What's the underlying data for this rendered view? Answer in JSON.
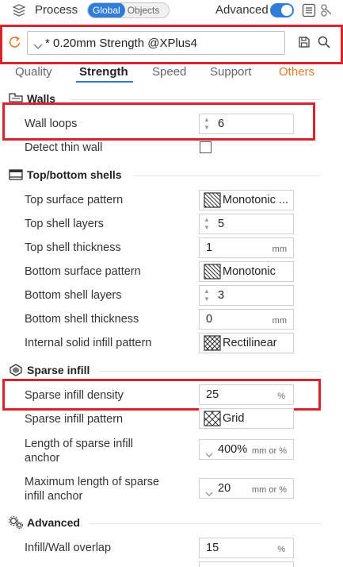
{
  "header": {
    "title": "Process",
    "seg_global": "Global",
    "seg_objects": "Objects",
    "advanced_label": "Advanced"
  },
  "preset": {
    "name": "* 0.20mm Strength @XPlus4"
  },
  "tabs": [
    "Quality",
    "Strength",
    "Speed",
    "Support",
    "Others"
  ],
  "sections": {
    "walls": "Walls",
    "top_bottom": "Top/bottom shells",
    "sparse": "Sparse infill",
    "advanced": "Advanced"
  },
  "settings": {
    "wall_loops": {
      "label": "Wall loops",
      "value": "6"
    },
    "detect_thin_wall": {
      "label": "Detect thin wall"
    },
    "top_surface_pattern": {
      "label": "Top surface pattern",
      "value": "Monotonic ..."
    },
    "top_shell_layers": {
      "label": "Top shell layers",
      "value": "5"
    },
    "top_shell_thickness": {
      "label": "Top shell thickness",
      "value": "1",
      "unit": "mm"
    },
    "bottom_surface_pattern": {
      "label": "Bottom surface pattern",
      "value": "Monotonic"
    },
    "bottom_shell_layers": {
      "label": "Bottom shell layers",
      "value": "3"
    },
    "bottom_shell_thickness": {
      "label": "Bottom shell thickness",
      "value": "0",
      "unit": "mm"
    },
    "internal_solid_infill_pattern": {
      "label": "Internal solid infill pattern",
      "value": "Rectilinear"
    },
    "sparse_infill_density": {
      "label": "Sparse infill density",
      "value": "25",
      "unit": "%"
    },
    "sparse_infill_pattern": {
      "label": "Sparse infill pattern",
      "value": "Grid"
    },
    "sparse_anchor_length": {
      "label_1": "Length of sparse infill",
      "label_2": "anchor",
      "value": "400%",
      "unit": "mm or %"
    },
    "sparse_anchor_max": {
      "label_1": "Maximum length of sparse",
      "label_2": "infill anchor",
      "value": "20",
      "unit": "mm or %"
    },
    "infill_wall_overlap": {
      "label": "Infill/Wall overlap",
      "value": "15",
      "unit": "%"
    }
  },
  "colors": {
    "accent": "#2f7dd8",
    "highlight": "#d9242c",
    "others_tab": "#e8782b"
  }
}
